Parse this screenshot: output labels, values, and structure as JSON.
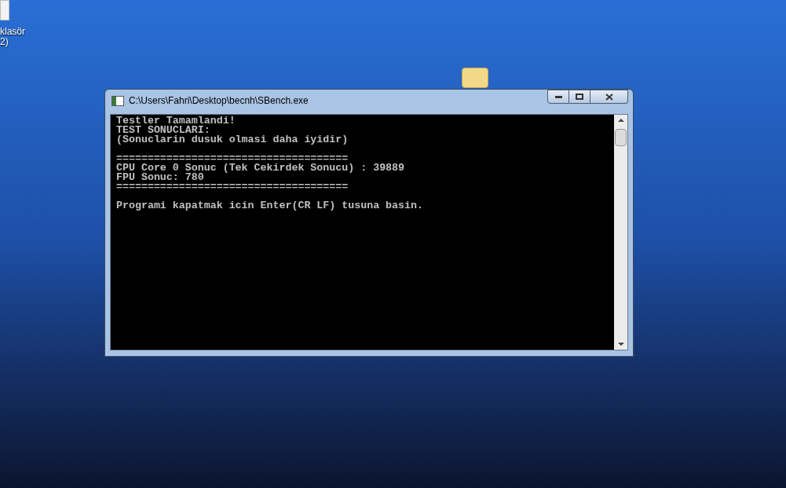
{
  "desktop_icons": [
    {
      "kind": "document",
      "label_lines": [
        "klasör",
        "2)"
      ]
    },
    {
      "kind": "folder"
    }
  ],
  "window": {
    "title": "C:\\Users\\Fahri\\Desktop\\becnh\\SBench.exe"
  },
  "console": {
    "blocks": [
      [
        "Testler Tamamlandi!",
        "TEST SONUCLARI:",
        "(Sonuclarin dusuk olmasi daha iyidir)"
      ],
      [
        "=====================================",
        "CPU Core 0 Sonuc (Tek Cekirdek Sonucu) : 39889",
        "FPU Sonuc: 780",
        "====================================="
      ],
      [
        "Programi kapatmak icin Enter(CR LF) tusuna basin."
      ]
    ]
  }
}
